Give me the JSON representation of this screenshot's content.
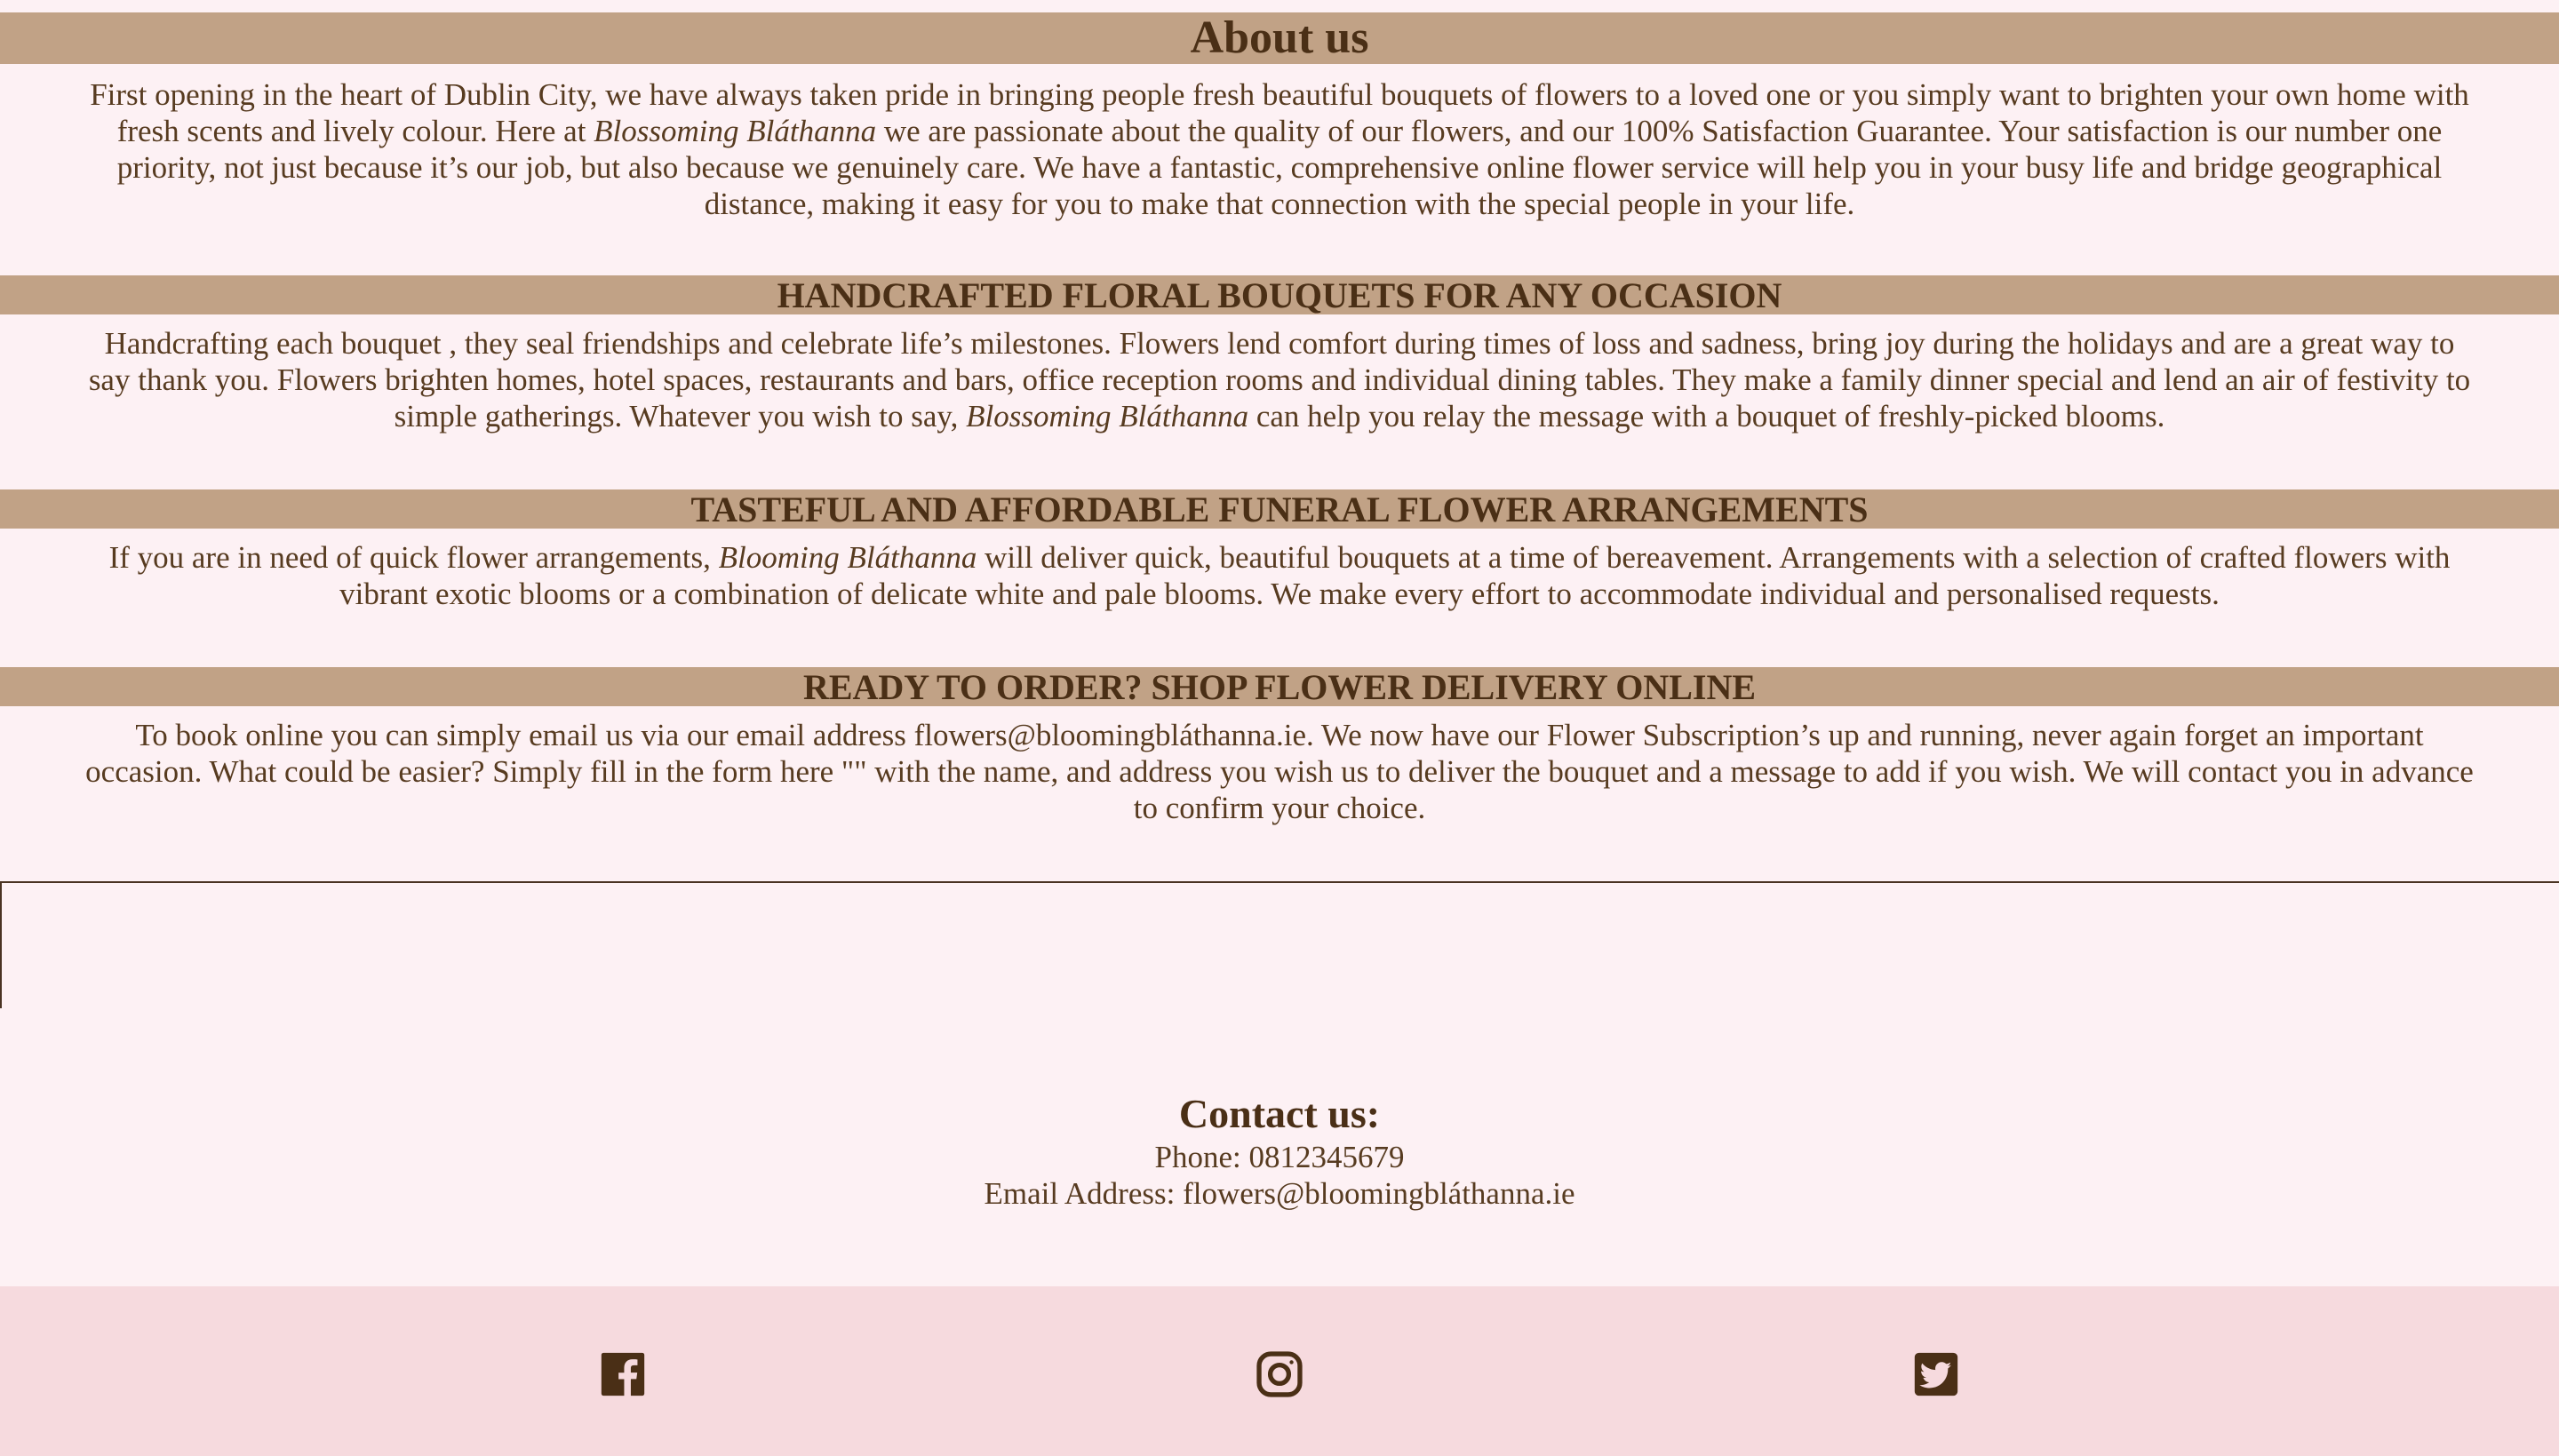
{
  "about": {
    "title": "About us",
    "text_before": "First opening in the heart of Dublin City, we have always taken pride in bringing people fresh beautiful bouquets of flowers to a loved one or you simply want to brighten your own home with fresh scents and lively colour. Here at ",
    "brand": "Blossoming Bláthanna",
    "text_after": " we are passionate about the quality of our flowers, and our 100% Satisfaction Guarantee. Your satisfaction is our number one priority, not just because it’s our job, but also because we genuinely care. We have a fantastic, comprehensive online flower service will help you in your busy life and bridge geographical distance, making it easy for you to make that connection with the special people in your life."
  },
  "handcrafted": {
    "title": "HANDCRAFTED FLORAL BOUQUETS FOR ANY OCCASION",
    "text_before": "Handcrafting each bouquet , they seal friendships and celebrate life’s milestones. Flowers lend comfort during times of loss and sadness, bring joy during the holidays and are a great way to say thank you. Flowers brighten homes, hotel spaces, restaurants and bars, office reception rooms and individual dining tables. They make a family dinner special and lend an air of festivity to simple gatherings. Whatever you wish to say, ",
    "brand": "Blossoming Bláthanna",
    "text_after": " can help you relay the message with a bouquet of freshly-picked blooms."
  },
  "funeral": {
    "title": "TASTEFUL AND AFFORDABLE FUNERAL FLOWER ARRANGEMENTS",
    "text_before": "If you are in need of quick flower arrangements, ",
    "brand": "Blooming Bláthanna",
    "text_after": " will deliver quick, beautiful bouquets at a time of bereavement. Arrangements with a selection of crafted flowers with vibrant exotic blooms or a combination of delicate white and pale blooms. We make every effort to accommodate individual and personalised requests."
  },
  "order": {
    "title": "READY TO ORDER? SHOP FLOWER DELIVERY ONLINE",
    "text": "To book online you can simply email us via our email address flowers@bloomingbláthanna.ie. We now have our Flower Subscription’s up and running, never again forget an important occasion. What could be easier? Simply fill in the form here \"\" with the name, and address you wish us to deliver the bouquet and a message to add if you wish. We will contact you in advance to confirm your choice."
  },
  "contact": {
    "title": "Contact us:",
    "phone": "Phone: 0812345679",
    "email": "Email Address: flowers@bloomingbláthanna.ie"
  },
  "footer": {
    "icons": [
      "facebook-icon",
      "instagram-icon",
      "twitter-icon"
    ]
  },
  "colors": {
    "page_bg": "#fdf1f4",
    "band_bg": "#c1a286",
    "text": "#573b20",
    "footer_bg": "#f6dade"
  }
}
